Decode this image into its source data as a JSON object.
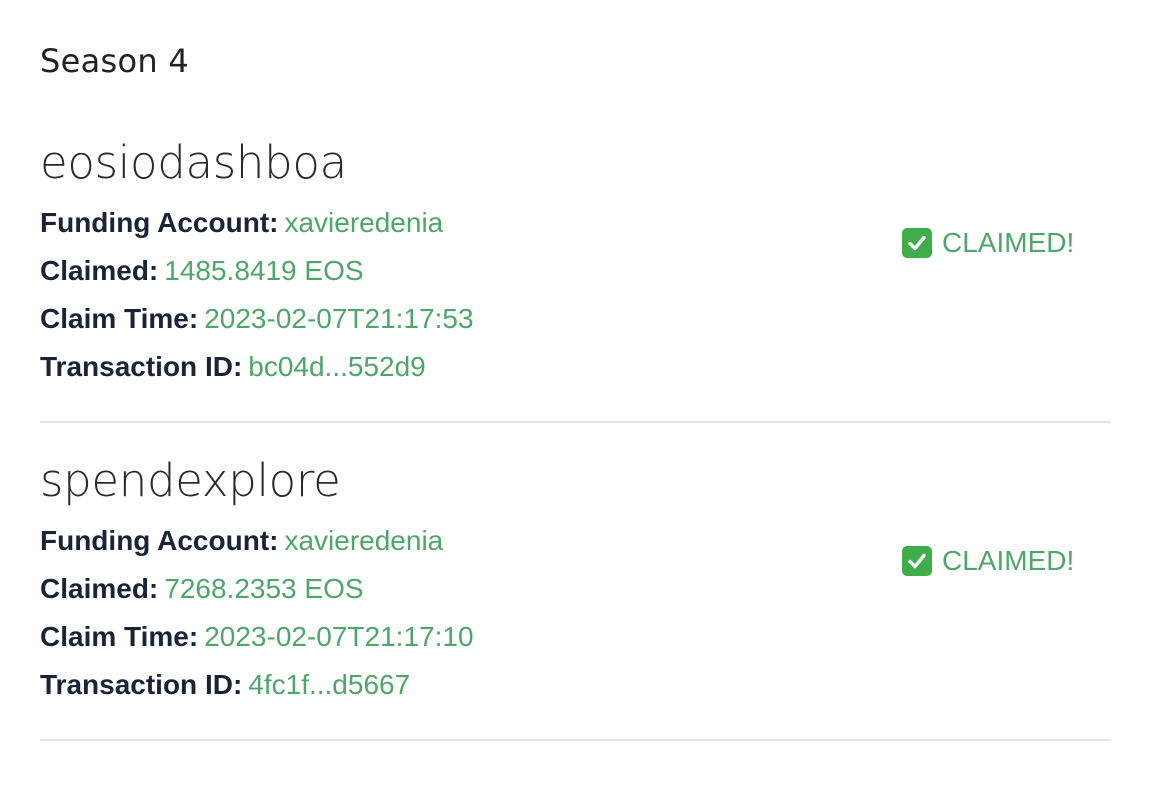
{
  "season_title": "Season 4",
  "claims": [
    {
      "account": "eosiodashboa",
      "fields": [
        {
          "label": "Funding Account:",
          "value": "xavieredenia"
        },
        {
          "label": "Claimed:",
          "value": "1485.8419 EOS"
        },
        {
          "label": "Claim Time:",
          "value": "2023-02-07T21:17:53"
        },
        {
          "label": "Transaction ID:",
          "value": "bc04d...552d9"
        }
      ],
      "status": "CLAIMED!",
      "status_icon": "check-mark-button-icon"
    },
    {
      "account": "spendexplore",
      "fields": [
        {
          "label": "Funding Account:",
          "value": "xavieredenia"
        },
        {
          "label": "Claimed:",
          "value": "7268.2353 EOS"
        },
        {
          "label": "Claim Time:",
          "value": "2023-02-07T21:17:10"
        },
        {
          "label": "Transaction ID:",
          "value": "4fc1f...d5667"
        }
      ],
      "status": "CLAIMED!",
      "status_icon": "check-mark-button-icon"
    }
  ],
  "colors": {
    "accent_green": "#4ea66a",
    "label_dark": "#1b2336",
    "check_box_green": "#3fae4a"
  }
}
